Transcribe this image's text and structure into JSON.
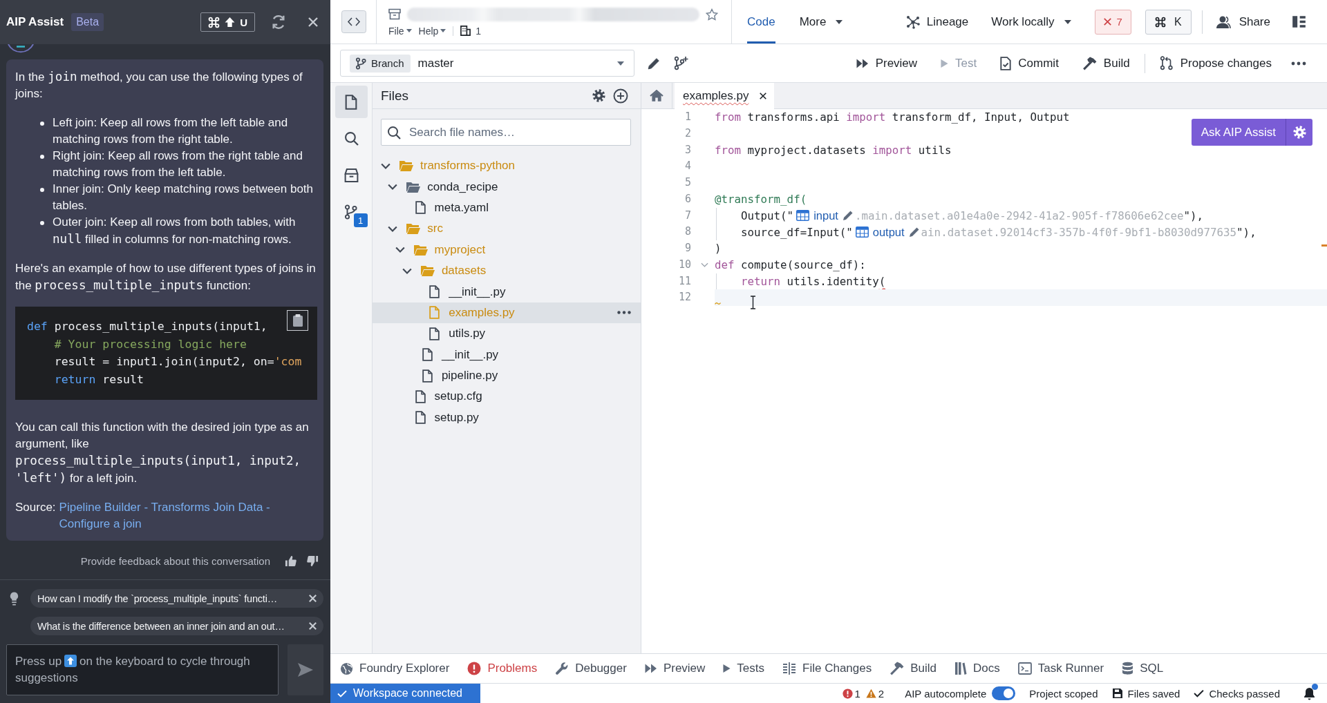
{
  "assistant": {
    "title": "AIP Assist",
    "badge": "Beta",
    "shortcut_key": "U",
    "message": {
      "blocks": [
        {
          "kind": "paragraph",
          "parts": [
            {
              "kind": "text",
              "text": "In the "
            },
            {
              "kind": "code",
              "text": "join"
            },
            {
              "kind": "text",
              "text": " method, you can use the following types of joins:"
            }
          ]
        },
        {
          "kind": "list",
          "items": [
            {
              "parts": [
                {
                  "kind": "text",
                  "text": "Left join: Keep all rows from the left table and matching rows from the right table."
                }
              ]
            },
            {
              "parts": [
                {
                  "kind": "text",
                  "text": "Right join: Keep all rows from the right table and matching rows from the left table."
                }
              ]
            },
            {
              "parts": [
                {
                  "kind": "text",
                  "text": "Inner join: Only keep matching rows between both tables."
                }
              ]
            },
            {
              "parts": [
                {
                  "kind": "text",
                  "text": "Outer join: Keep all rows from both tables, with "
                },
                {
                  "kind": "code",
                  "text": "null"
                },
                {
                  "kind": "text",
                  "text": " filled in columns for non-matching rows."
                }
              ]
            }
          ]
        },
        {
          "kind": "paragraph",
          "parts": [
            {
              "kind": "text",
              "text": "Here's an example of how to use different types of joins in the "
            },
            {
              "kind": "code",
              "text": "process_multiple_inputs"
            },
            {
              "kind": "text",
              "text": " function:"
            }
          ]
        },
        {
          "kind": "code_block",
          "lines": [
            [
              {
                "kind": "keyword",
                "text": "def"
              },
              {
                "kind": "plain",
                "text": " process_multiple_inputs(input1,"
              }
            ],
            [
              {
                "kind": "comment",
                "text": "    # Your processing logic here"
              }
            ],
            [
              {
                "kind": "plain",
                "text": "    result = input1.join(input2, on="
              },
              {
                "kind": "string",
                "text": "'com"
              }
            ],
            [
              {
                "kind": "keyword",
                "text": "    return"
              },
              {
                "kind": "plain",
                "text": " result"
              }
            ]
          ]
        },
        {
          "kind": "paragraph",
          "parts": [
            {
              "kind": "text",
              "text": "You can call this function with the desired join type as an argument, like "
            },
            {
              "kind": "code",
              "text": "process_multiple_inputs(input1, input2, 'left')"
            },
            {
              "kind": "text",
              "text": " for a left join."
            }
          ]
        },
        {
          "kind": "source",
          "label": "Source:",
          "link": "Pipeline Builder - Transforms Join Data - Configure a join"
        }
      ]
    },
    "feedback": "Provide feedback about this conversation",
    "suggestions": [
      {
        "text": "How can I modify the `process_multiple_inputs` functi…"
      },
      {
        "text": "What is the difference between an inner join and an out…"
      }
    ],
    "composer": {
      "placeholder_before": "Press up",
      "placeholder_after": "on the keyboard to cycle through suggestions"
    }
  },
  "top_bar": {
    "menus": [
      {
        "label": "File"
      },
      {
        "label": "Help"
      }
    ],
    "org_count": "1",
    "tabs": [
      {
        "label": "Code",
        "selected": true,
        "dropdown": false
      },
      {
        "label": "More",
        "selected": false,
        "dropdown": true
      }
    ],
    "lineage": "Lineage",
    "work_locally": "Work locally",
    "error_count": "7",
    "shortcut_key": "K",
    "share": "Share"
  },
  "branch_bar": {
    "tag": "Branch",
    "branch": "master",
    "actions": [
      {
        "kind": "preview",
        "label": "Preview",
        "disabled": false
      },
      {
        "kind": "test",
        "label": "Test",
        "disabled": true
      },
      {
        "kind": "commit",
        "label": "Commit",
        "disabled": false
      },
      {
        "kind": "build",
        "label": "Build",
        "disabled": false
      }
    ],
    "propose": "Propose changes"
  },
  "rail": [
    {
      "kind": "files",
      "selected": true
    },
    {
      "kind": "search",
      "selected": false
    },
    {
      "kind": "package",
      "selected": false
    },
    {
      "kind": "git",
      "selected": false,
      "badge": "1"
    }
  ],
  "files_panel": {
    "title": "Files",
    "search": {
      "placeholder": "Search file names…"
    },
    "tree": [
      {
        "kind": "folder",
        "name": "transforms-python",
        "expanded": true,
        "highlighted": true,
        "selected": false,
        "children": [
          {
            "kind": "folder",
            "name": "conda_recipe",
            "expanded": true,
            "highlighted": false,
            "selected": false,
            "children": [
              {
                "kind": "file",
                "name": "meta.yaml",
                "highlighted": false,
                "selected": false
              }
            ]
          },
          {
            "kind": "folder",
            "name": "src",
            "expanded": true,
            "highlighted": true,
            "selected": false,
            "children": [
              {
                "kind": "folder",
                "name": "myproject",
                "expanded": true,
                "highlighted": true,
                "selected": false,
                "children": [
                  {
                    "kind": "folder",
                    "name": "datasets",
                    "expanded": true,
                    "highlighted": true,
                    "selected": false,
                    "children": [
                      {
                        "kind": "file",
                        "name": "__init__.py",
                        "highlighted": false,
                        "selected": false
                      },
                      {
                        "kind": "file",
                        "name": "examples.py",
                        "highlighted": true,
                        "selected": true
                      },
                      {
                        "kind": "file",
                        "name": "utils.py",
                        "highlighted": false,
                        "selected": false
                      }
                    ]
                  },
                  {
                    "kind": "file",
                    "name": "__init__.py",
                    "highlighted": false,
                    "selected": false
                  },
                  {
                    "kind": "file",
                    "name": "pipeline.py",
                    "highlighted": false,
                    "selected": false
                  }
                ]
              },
              {
                "kind": "file",
                "name": "setup.cfg",
                "highlighted": false,
                "selected": false
              },
              {
                "kind": "file",
                "name": "setup.py",
                "highlighted": false,
                "selected": false
              }
            ]
          }
        ]
      }
    ]
  },
  "editor": {
    "tabs": [
      {
        "label": "examples.py",
        "selected": true,
        "error": true
      }
    ],
    "assist_button": "Ask AIP Assist",
    "lines": [
      {
        "number": "1",
        "current": false,
        "foldable": false,
        "warning": false,
        "tokens": [
          {
            "kind": "keyword",
            "text": "from"
          },
          {
            "kind": "plain",
            "text": " transforms.api "
          },
          {
            "kind": "keyword",
            "text": "import"
          },
          {
            "kind": "plain",
            "text": " transform_df, Input, Output"
          }
        ]
      },
      {
        "number": "2",
        "current": false,
        "foldable": false,
        "warning": false
      },
      {
        "number": "3",
        "current": false,
        "foldable": false,
        "warning": false,
        "tokens": [
          {
            "kind": "keyword",
            "text": "from"
          },
          {
            "kind": "plain",
            "text": " myproject.datasets "
          },
          {
            "kind": "keyword",
            "text": "import"
          },
          {
            "kind": "plain",
            "text": " utils"
          }
        ]
      },
      {
        "number": "4",
        "current": false,
        "foldable": false,
        "warning": false
      },
      {
        "number": "5",
        "current": false,
        "foldable": false,
        "warning": false
      },
      {
        "number": "6",
        "current": false,
        "foldable": false,
        "warning": false,
        "tokens": [
          {
            "kind": "decorator",
            "text": "@transform_df("
          }
        ]
      },
      {
        "number": "7",
        "current": false,
        "foldable": false,
        "warning": false,
        "tokens": [
          {
            "kind": "plain",
            "text": "    Output(\""
          },
          {
            "kind": "dataset",
            "text": "input"
          },
          {
            "kind": "path",
            "text": ".main.dataset.a01e4a0e-2942-41a2-905f-f78606e62cee"
          },
          {
            "kind": "plain",
            "text": "\"),"
          }
        ]
      },
      {
        "number": "8",
        "current": false,
        "foldable": false,
        "warning": false,
        "tokens": [
          {
            "kind": "plain",
            "text": "    source_df=Input(\""
          },
          {
            "kind": "dataset",
            "text": "output"
          },
          {
            "kind": "path",
            "text": "ain.dataset.92014cf3-357b-4f0f-9bf1-b8030d977635"
          },
          {
            "kind": "plain",
            "text": "\"),"
          }
        ]
      },
      {
        "number": "9",
        "current": false,
        "foldable": false,
        "warning": false,
        "tokens": [
          {
            "kind": "plain",
            "text": ")"
          }
        ]
      },
      {
        "number": "10",
        "current": false,
        "foldable": true,
        "warning": false,
        "tokens": [
          {
            "kind": "keyword",
            "text": "def"
          },
          {
            "kind": "plain",
            "text": " compute(source_df):"
          }
        ]
      },
      {
        "number": "11",
        "current": false,
        "foldable": false,
        "warning": false,
        "tokens": [
          {
            "kind": "keyword",
            "text": "    return"
          },
          {
            "kind": "plain",
            "text": " utils.identity"
          },
          {
            "kind": "error",
            "text": "("
          }
        ]
      },
      {
        "number": "12",
        "current": true,
        "foldable": false,
        "warning": true
      }
    ]
  },
  "bottom_tabs": [
    {
      "kind": "explorer",
      "label": "Foundry Explorer",
      "alert": false
    },
    {
      "kind": "problems",
      "label": "Problems",
      "alert": true
    },
    {
      "kind": "debugger",
      "label": "Debugger",
      "alert": false
    },
    {
      "kind": "preview",
      "label": "Preview",
      "alert": false
    },
    {
      "kind": "tests",
      "label": "Tests",
      "alert": false
    },
    {
      "kind": "changes",
      "label": "File Changes",
      "alert": false
    },
    {
      "kind": "build",
      "label": "Build",
      "alert": false
    },
    {
      "kind": "docs",
      "label": "Docs",
      "alert": false
    },
    {
      "kind": "terminal",
      "label": "Task Runner",
      "alert": false
    },
    {
      "kind": "sql",
      "label": "SQL",
      "alert": false
    }
  ],
  "status_bar": {
    "connection": "Workspace connected",
    "errors": "1",
    "warnings": "2",
    "autocomplete": {
      "label": "AIP autocomplete",
      "on": true
    },
    "scope": "Project scoped",
    "saved": "Files saved",
    "checks": "Checks passed",
    "unread": true
  }
}
